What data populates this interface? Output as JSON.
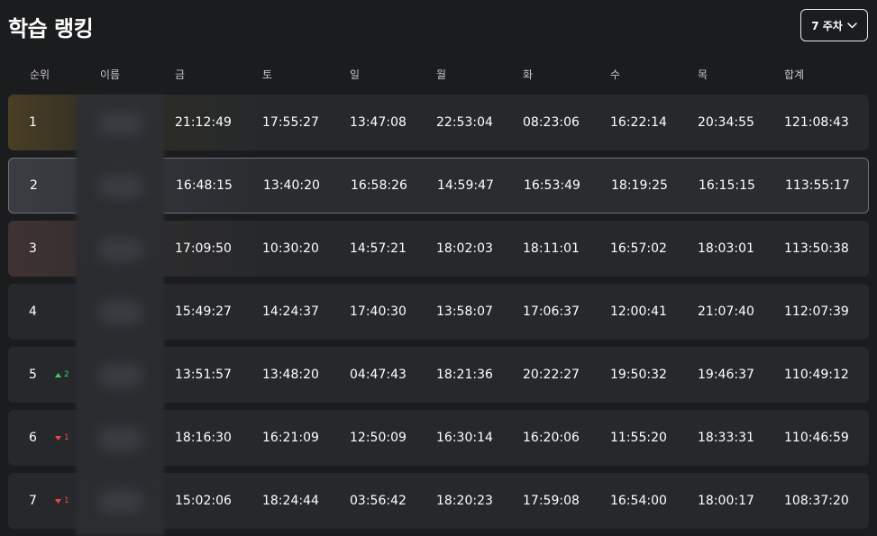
{
  "title": "학습 랭킹",
  "week_selector": {
    "label": "7 주차",
    "icon": "chevron-down-icon"
  },
  "columns": [
    "순위",
    "이름",
    "금",
    "토",
    "일",
    "월",
    "화",
    "수",
    "목",
    "합계"
  ],
  "rows": [
    {
      "rank": "1",
      "change": "",
      "change_dir": "",
      "times": [
        "21:12:49",
        "17:55:27",
        "13:47:08",
        "22:53:04",
        "08:23:06",
        "16:22:14",
        "20:34:55"
      ],
      "total": "121:08:43"
    },
    {
      "rank": "2",
      "change": "",
      "change_dir": "",
      "times": [
        "16:48:15",
        "13:40:20",
        "16:58:26",
        "14:59:47",
        "16:53:49",
        "18:19:25",
        "16:15:15"
      ],
      "total": "113:55:17"
    },
    {
      "rank": "3",
      "change": "",
      "change_dir": "",
      "times": [
        "17:09:50",
        "10:30:20",
        "14:57:21",
        "18:02:03",
        "18:11:01",
        "16:57:02",
        "18:03:01"
      ],
      "total": "113:50:38"
    },
    {
      "rank": "4",
      "change": "",
      "change_dir": "",
      "times": [
        "15:49:27",
        "14:24:37",
        "17:40:30",
        "13:58:07",
        "17:06:37",
        "12:00:41",
        "21:07:40"
      ],
      "total": "112:07:39"
    },
    {
      "rank": "5",
      "change": "2",
      "change_dir": "up",
      "times": [
        "13:51:57",
        "13:48:20",
        "04:47:43",
        "18:21:36",
        "20:22:27",
        "19:50:32",
        "19:46:37"
      ],
      "total": "110:49:12"
    },
    {
      "rank": "6",
      "change": "1",
      "change_dir": "down",
      "times": [
        "18:16:30",
        "16:21:09",
        "12:50:09",
        "16:30:14",
        "16:20:06",
        "11:55:20",
        "18:33:31"
      ],
      "total": "110:46:59"
    },
    {
      "rank": "7",
      "change": "1",
      "change_dir": "down",
      "times": [
        "15:02:06",
        "18:24:44",
        "03:56:42",
        "18:20:23",
        "17:59:08",
        "16:54:00",
        "18:00:17"
      ],
      "total": "108:37:20"
    }
  ],
  "colors": {
    "background": "#1b1c1e",
    "row": "#26282c",
    "up": "#3ecf5a",
    "down": "#f04848"
  }
}
